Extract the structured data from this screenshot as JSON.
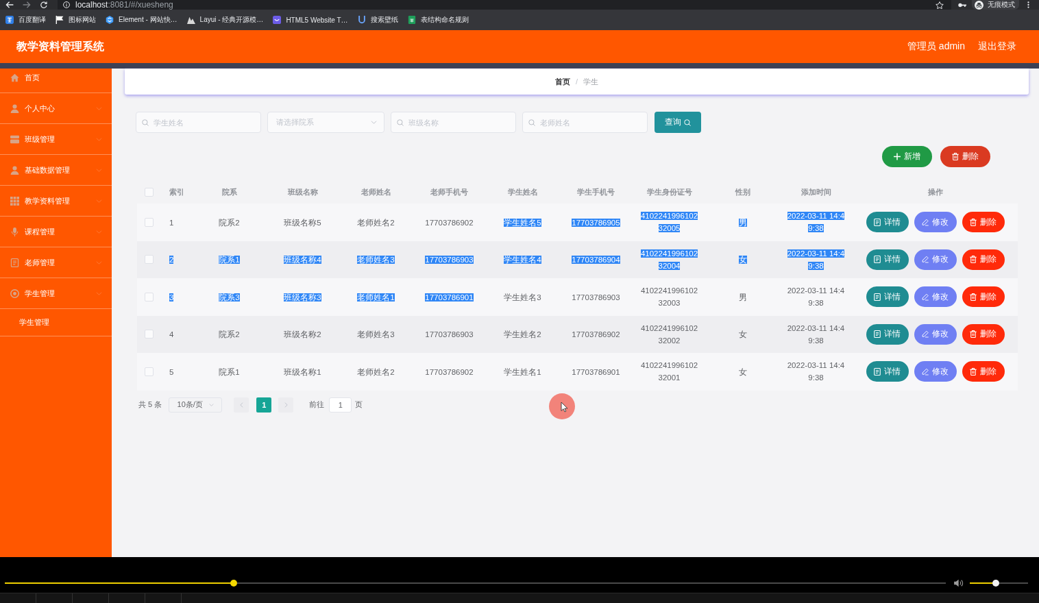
{
  "browser": {
    "url": {
      "host": "localhost",
      "path": ":8081/#/xuesheng"
    },
    "profile_label": "无痕模式",
    "bookmarks": [
      {
        "label": "百度翻译"
      },
      {
        "label": "图标网站"
      },
      {
        "label": "Element - 网站快…"
      },
      {
        "label": "Layui - 经典开源模…"
      },
      {
        "label": "HTML5 Website T…"
      },
      {
        "label": "搜索壁纸"
      },
      {
        "label": "表结构命名规则"
      }
    ]
  },
  "header": {
    "title": "教学资料管理系统",
    "user": "管理员 admin",
    "logout": "退出登录"
  },
  "sidebar": {
    "items": [
      {
        "label": "首页",
        "kind": "link"
      },
      {
        "label": "个人中心",
        "kind": "submenu"
      },
      {
        "label": "班级管理",
        "kind": "submenu"
      },
      {
        "label": "基础数据管理",
        "kind": "submenu"
      },
      {
        "label": "教学资料管理",
        "kind": "submenu"
      },
      {
        "label": "课程管理",
        "kind": "submenu"
      },
      {
        "label": "老师管理",
        "kind": "submenu"
      },
      {
        "label": "学生管理",
        "kind": "submenu",
        "children": [
          {
            "label": "学生管理"
          }
        ]
      }
    ]
  },
  "breadcrumb": {
    "separator": "/",
    "items": [
      {
        "label": "首页",
        "current": false
      },
      {
        "label": "学生",
        "current": true
      }
    ]
  },
  "search": {
    "fields": [
      {
        "kind": "input",
        "placeholder": "学生姓名"
      },
      {
        "kind": "select",
        "placeholder": "请选择院系"
      },
      {
        "kind": "input",
        "placeholder": "班级名称"
      },
      {
        "kind": "input",
        "placeholder": "老师姓名"
      }
    ],
    "button": "查询"
  },
  "toolbar": [
    {
      "kind": "add",
      "label": "新增"
    },
    {
      "kind": "delete",
      "label": "删除"
    }
  ],
  "table": {
    "select_all": {
      "checked": false
    },
    "columns": [
      "索引",
      "院系",
      "班级名称",
      "老师姓名",
      "老师手机号",
      "学生姓名",
      "学生手机号",
      "学生身份证号",
      "性别",
      "添加时间",
      "操作"
    ],
    "rows": [
      {
        "checked": false,
        "cells": [
          {
            "text": "1",
            "highlighted": false
          },
          {
            "text": "院系2",
            "highlighted": false
          },
          {
            "text": "班级名称5",
            "highlighted": false
          },
          {
            "text": "老师姓名2",
            "highlighted": false
          },
          {
            "text": "17703786902",
            "highlighted": false
          },
          {
            "text": "学生姓名5",
            "highlighted": true
          },
          {
            "text": "17703786905",
            "highlighted": true
          },
          {
            "text": "410224199610232005",
            "highlighted": true
          },
          {
            "text": "男",
            "highlighted": true
          },
          {
            "text": "2022-03-11 14:49:38",
            "highlighted": true
          }
        ],
        "actions": [
          {
            "kind": "detail",
            "label": "详情"
          },
          {
            "kind": "edit",
            "label": "修改"
          },
          {
            "kind": "delete",
            "label": "删除"
          }
        ]
      },
      {
        "checked": false,
        "cells": [
          {
            "text": "2",
            "highlighted": true
          },
          {
            "text": "院系1",
            "highlighted": true
          },
          {
            "text": "班级名称4",
            "highlighted": true
          },
          {
            "text": "老师姓名3",
            "highlighted": true
          },
          {
            "text": "17703786903",
            "highlighted": true
          },
          {
            "text": "学生姓名4",
            "highlighted": true
          },
          {
            "text": "17703786904",
            "highlighted": true
          },
          {
            "text": "410224199610232004",
            "highlighted": true
          },
          {
            "text": "女",
            "highlighted": true
          },
          {
            "text": "2022-03-11 14:49:38",
            "highlighted": true
          }
        ],
        "actions": [
          {
            "kind": "detail",
            "label": "详情"
          },
          {
            "kind": "edit",
            "label": "修改"
          },
          {
            "kind": "delete",
            "label": "删除"
          }
        ]
      },
      {
        "checked": false,
        "cells": [
          {
            "text": "3",
            "highlighted": true
          },
          {
            "text": "院系3",
            "highlighted": true
          },
          {
            "text": "班级名称3",
            "highlighted": true
          },
          {
            "text": "老师姓名1",
            "highlighted": true
          },
          {
            "text": "17703786901",
            "highlighted": true
          },
          {
            "text": "学生姓名3",
            "highlighted": false
          },
          {
            "text": "17703786903",
            "highlighted": false
          },
          {
            "text": "410224199610232003",
            "highlighted": false
          },
          {
            "text": "男",
            "highlighted": false
          },
          {
            "text": "2022-03-11 14:49:38",
            "highlighted": false
          }
        ],
        "actions": [
          {
            "kind": "detail",
            "label": "详情"
          },
          {
            "kind": "edit",
            "label": "修改"
          },
          {
            "kind": "delete",
            "label": "删除"
          }
        ]
      },
      {
        "checked": false,
        "cells": [
          {
            "text": "4",
            "highlighted": false
          },
          {
            "text": "院系2",
            "highlighted": false
          },
          {
            "text": "班级名称2",
            "highlighted": false
          },
          {
            "text": "老师姓名3",
            "highlighted": false
          },
          {
            "text": "17703786903",
            "highlighted": false
          },
          {
            "text": "学生姓名2",
            "highlighted": false
          },
          {
            "text": "17703786902",
            "highlighted": false
          },
          {
            "text": "410224199610232002",
            "highlighted": false
          },
          {
            "text": "女",
            "highlighted": false
          },
          {
            "text": "2022-03-11 14:49:38",
            "highlighted": false
          }
        ],
        "actions": [
          {
            "kind": "detail",
            "label": "详情"
          },
          {
            "kind": "edit",
            "label": "修改"
          },
          {
            "kind": "delete",
            "label": "删除"
          }
        ]
      },
      {
        "checked": false,
        "cells": [
          {
            "text": "5",
            "highlighted": false
          },
          {
            "text": "院系1",
            "highlighted": false
          },
          {
            "text": "班级名称1",
            "highlighted": false
          },
          {
            "text": "老师姓名2",
            "highlighted": false
          },
          {
            "text": "17703786902",
            "highlighted": false
          },
          {
            "text": "学生姓名1",
            "highlighted": false
          },
          {
            "text": "17703786901",
            "highlighted": false
          },
          {
            "text": "410224199610232001",
            "highlighted": false
          },
          {
            "text": "女",
            "highlighted": false
          },
          {
            "text": "2022-03-11 14:49:38",
            "highlighted": false
          }
        ],
        "actions": [
          {
            "kind": "detail",
            "label": "详情"
          },
          {
            "kind": "edit",
            "label": "修改"
          },
          {
            "kind": "delete",
            "label": "删除"
          }
        ]
      }
    ]
  },
  "pagination": {
    "total": "共 5 条",
    "page_size": "10条/页",
    "prev": {
      "disabled": true
    },
    "pages": [
      {
        "label": "1",
        "selected": true
      }
    ],
    "next": {
      "disabled": true
    },
    "goto_label": "前往",
    "goto_value": "1",
    "goto_suffix": "页"
  },
  "player": {
    "progress": {
      "level": 0.243
    },
    "volume": {
      "level": 0.45
    }
  }
}
